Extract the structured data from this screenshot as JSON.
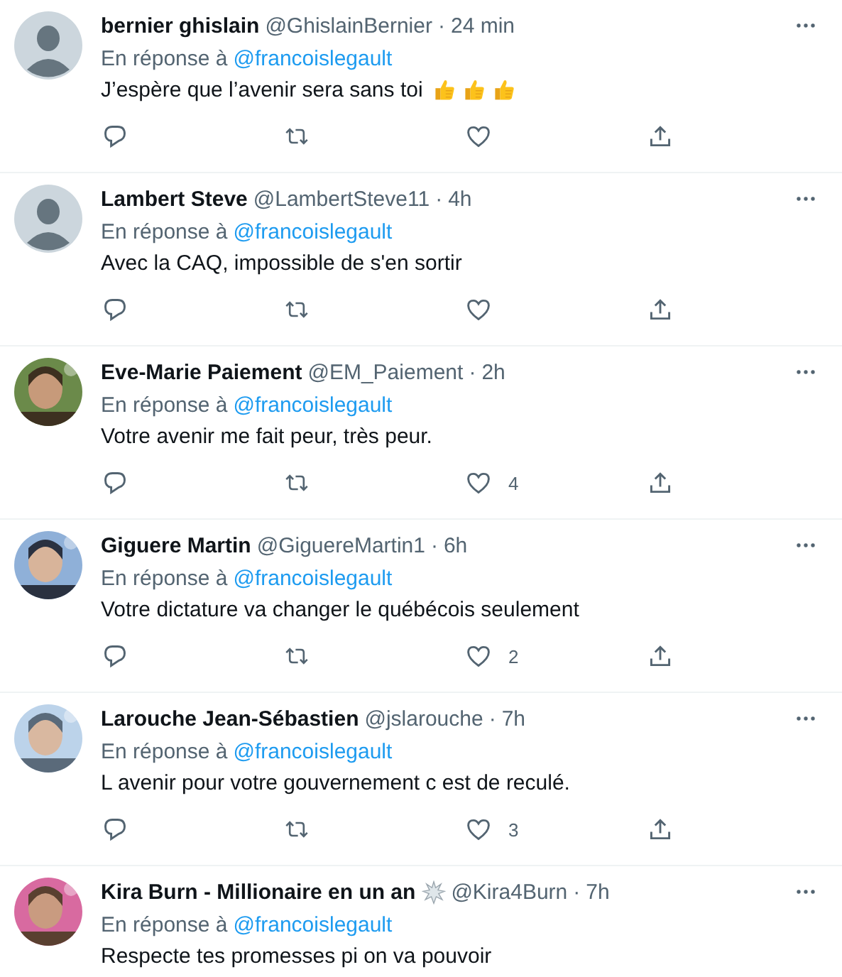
{
  "replies": [
    {
      "avatar": {
        "kind": "default"
      },
      "name": "bernier ghislain",
      "handle": "@GhislainBernier",
      "separator": "·",
      "time": "24 min",
      "reply_label": "En réponse à",
      "reply_to": "@francoislegault",
      "text": "J’espère que l’avenir sera sans toi",
      "emojis": [
        {
          "kind": "thumbs_up"
        },
        {
          "kind": "thumbs_up"
        },
        {
          "kind": "thumbs_up"
        }
      ],
      "actions": [
        {
          "kind": "reply"
        },
        {
          "kind": "retweet"
        },
        {
          "kind": "like"
        },
        {
          "kind": "share"
        }
      ]
    },
    {
      "avatar": {
        "kind": "default"
      },
      "name": "Lambert Steve",
      "handle": "@LambertSteve11",
      "separator": "·",
      "time": "4h",
      "reply_label": "En réponse à",
      "reply_to": "@francoislegault",
      "text": "Avec la CAQ, impossible de s'en sortir",
      "actions": [
        {
          "kind": "reply"
        },
        {
          "kind": "retweet"
        },
        {
          "kind": "like"
        },
        {
          "kind": "share"
        }
      ]
    },
    {
      "avatar": {
        "kind": "photo_green"
      },
      "name": "Eve-Marie Paiement",
      "handle": "@EM_Paiement",
      "separator": "·",
      "time": "2h",
      "reply_label": "En réponse à",
      "reply_to": "@francoislegault",
      "text": "Votre avenir me fait peur, très peur.",
      "actions": [
        {
          "kind": "reply"
        },
        {
          "kind": "retweet"
        },
        {
          "kind": "like",
          "count": "4"
        },
        {
          "kind": "share"
        }
      ]
    },
    {
      "avatar": {
        "kind": "photo_blue"
      },
      "name": "Giguere Martin",
      "handle": "@GiguereMartin1",
      "separator": "·",
      "time": "6h",
      "reply_label": "En réponse à",
      "reply_to": "@francoislegault",
      "text": "Votre dictature va changer le québécois seulement",
      "actions": [
        {
          "kind": "reply"
        },
        {
          "kind": "retweet"
        },
        {
          "kind": "like",
          "count": "2"
        },
        {
          "kind": "share"
        }
      ]
    },
    {
      "avatar": {
        "kind": "photo_sky"
      },
      "name": "Larouche Jean-Sébastien",
      "handle": "@jslarouche",
      "separator": "·",
      "time": "7h",
      "reply_label": "En réponse à",
      "reply_to": "@francoislegault",
      "text": "L avenir pour votre gouvernement c est de reculé.",
      "actions": [
        {
          "kind": "reply"
        },
        {
          "kind": "retweet"
        },
        {
          "kind": "like",
          "count": "3"
        },
        {
          "kind": "share"
        }
      ]
    },
    {
      "avatar": {
        "kind": "photo_pink"
      },
      "name": "Kira Burn - Millionaire en un an",
      "name_emoji": {
        "kind": "burst"
      },
      "handle": "@Kira4Burn",
      "separator": "·",
      "time": "7h",
      "reply_label": "En réponse à",
      "reply_to": "@francoislegault",
      "text": "Respecte tes promesses pi on va pouvoir"
    }
  ]
}
